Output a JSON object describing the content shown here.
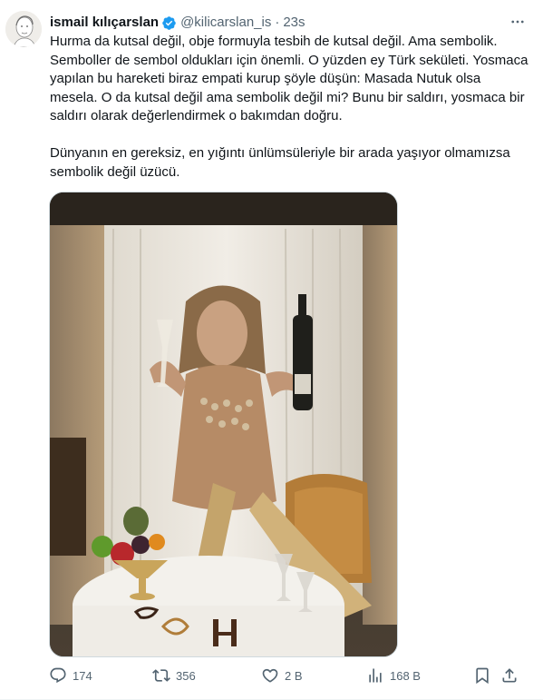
{
  "author": {
    "name": "ismail kılıçarslan",
    "handle": "@kilicarslan_is",
    "separator": "·",
    "time": "23s"
  },
  "tweet": {
    "paragraph1": "Hurma da kutsal değil, obje formuyla tesbih de kutsal değil. Ama sembolik. Semboller de sembol oldukları için önemli. O yüzden ey Türk sekületi. Yosmaca yapılan bu hareketi biraz empati kurup şöyle düşün: Masada Nutuk olsa mesela. O da kutsal değil ama sembolik değil mi? Bunu bir saldırı, yosmaca bir saldırı olarak değerlendirmek o bakımdan doğru.",
    "paragraph2": "Dünyanın en gereksiz, en yığıntı ünlümsüleriyle bir arada yaşıyor olmamızsa sembolik değil üzücü."
  },
  "actions": {
    "replies": "174",
    "reposts": "356",
    "likes": "2 B",
    "views": "168 B"
  },
  "icons": {
    "verified": "verified-badge-icon",
    "more": "more-icon",
    "reply": "reply-icon",
    "repost": "repost-icon",
    "like": "like-icon",
    "views": "views-icon",
    "bookmark": "bookmark-icon",
    "share": "share-icon"
  },
  "colors": {
    "text": "#0f1419",
    "secondary": "#536471",
    "verified": "#1d9bf0",
    "border": "#cfd9de"
  }
}
